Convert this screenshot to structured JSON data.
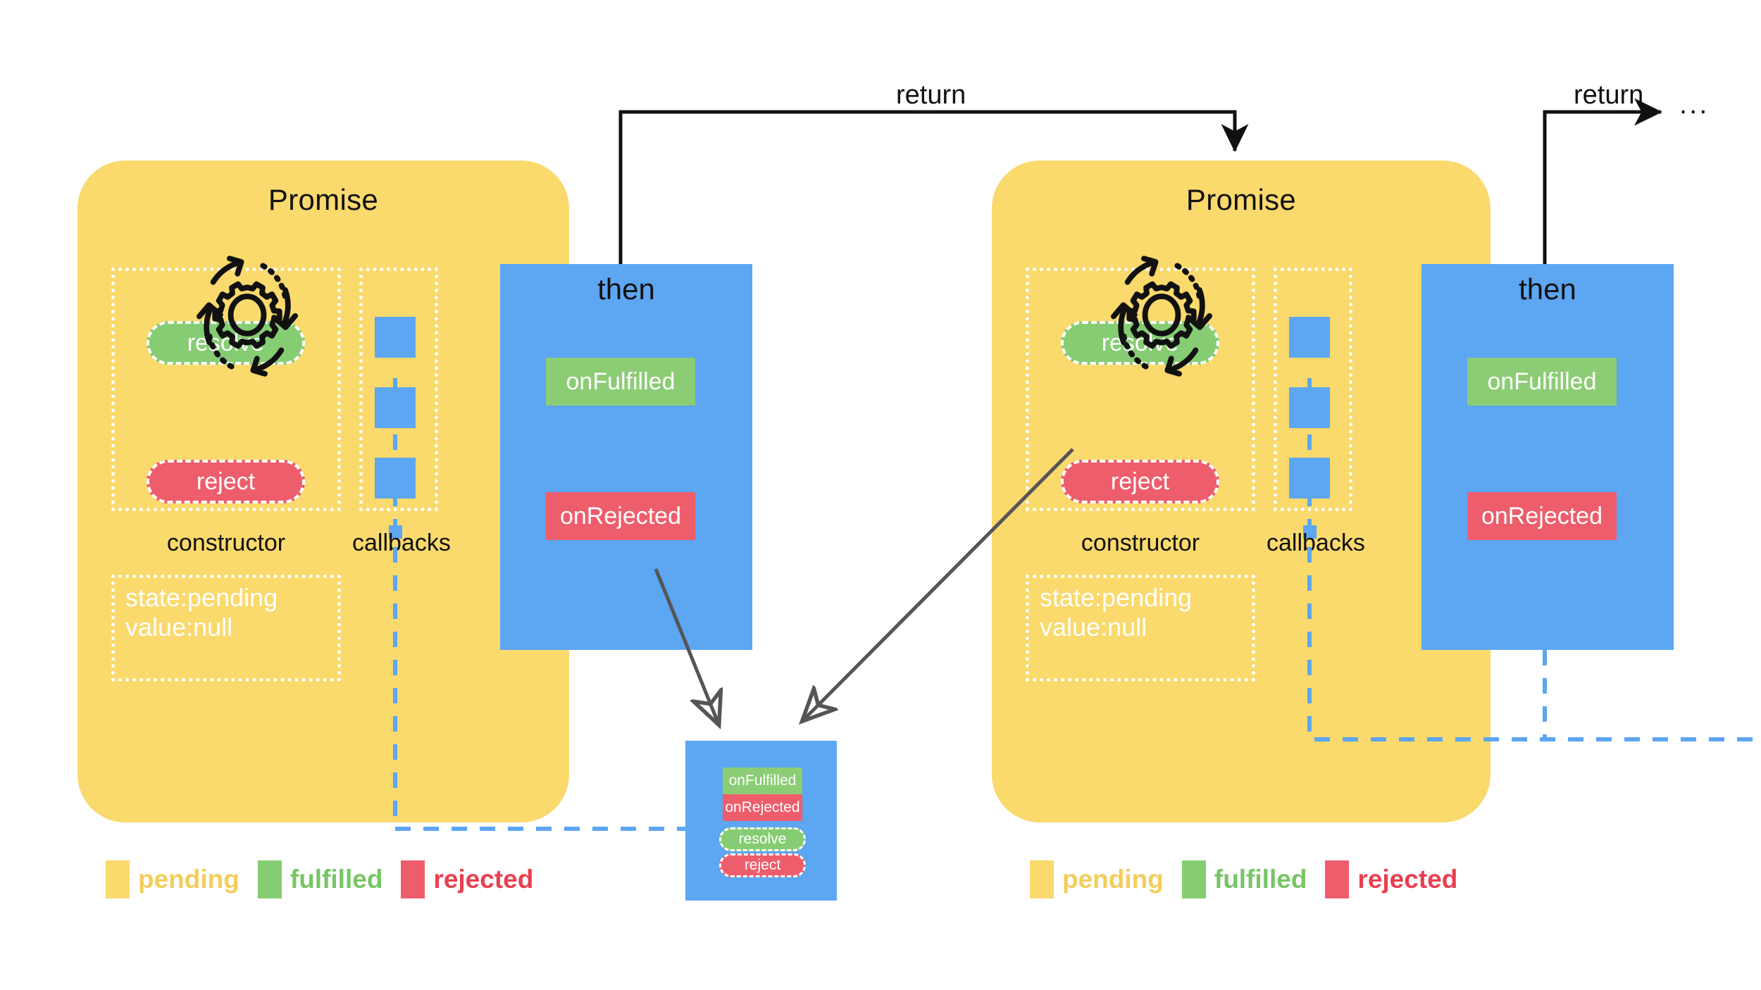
{
  "colors": {
    "pending": "#fad96d",
    "fulfilled": "#86cc73",
    "rejected": "#ee5d6b",
    "then_blue": "#5ca6f2",
    "arrow_black": "#111111",
    "arrow_gray": "#555555",
    "dash_blue": "#5ca6f2",
    "background": "#ffffff"
  },
  "promises": [
    {
      "title": "Promise",
      "constructor_label": "constructor",
      "callbacks_label": "callbacks",
      "resolve_label": "resolve",
      "reject_label": "reject",
      "gear_icon": "process-gear-icon",
      "state_line_1": "state:pending",
      "state_line_2": "value:null",
      "callback_slots": 3
    },
    {
      "title": "Promise",
      "constructor_label": "constructor",
      "callbacks_label": "callbacks",
      "resolve_label": "resolve",
      "reject_label": "reject",
      "gear_icon": "process-gear-icon",
      "state_line_1": "state:pending",
      "state_line_2": "value:null",
      "callback_slots": 3
    }
  ],
  "then_panels": [
    {
      "title": "then",
      "on_fulfilled_label": "onFulfilled",
      "on_rejected_label": "onRejected"
    },
    {
      "title": "then",
      "on_fulfilled_label": "onFulfilled",
      "on_rejected_label": "onRejected"
    }
  ],
  "mini_promise": {
    "on_fulfilled_label": "onFulfilled",
    "on_rejected_label": "onRejected",
    "resolve_label": "resolve",
    "reject_label": "reject"
  },
  "arrows": {
    "return_label_1": "return",
    "return_label_2": "return",
    "continuation_ellipsis": "..."
  },
  "legends": [
    {
      "items": [
        {
          "label": "pending",
          "color": "#fad96d"
        },
        {
          "label": "fulfilled",
          "color": "#86cc73"
        },
        {
          "label": "rejected",
          "color": "#ee5d6b"
        }
      ]
    },
    {
      "items": [
        {
          "label": "pending",
          "color": "#fad96d"
        },
        {
          "label": "fulfilled",
          "color": "#86cc73"
        },
        {
          "label": "rejected",
          "color": "#ee5d6b"
        }
      ]
    }
  ]
}
